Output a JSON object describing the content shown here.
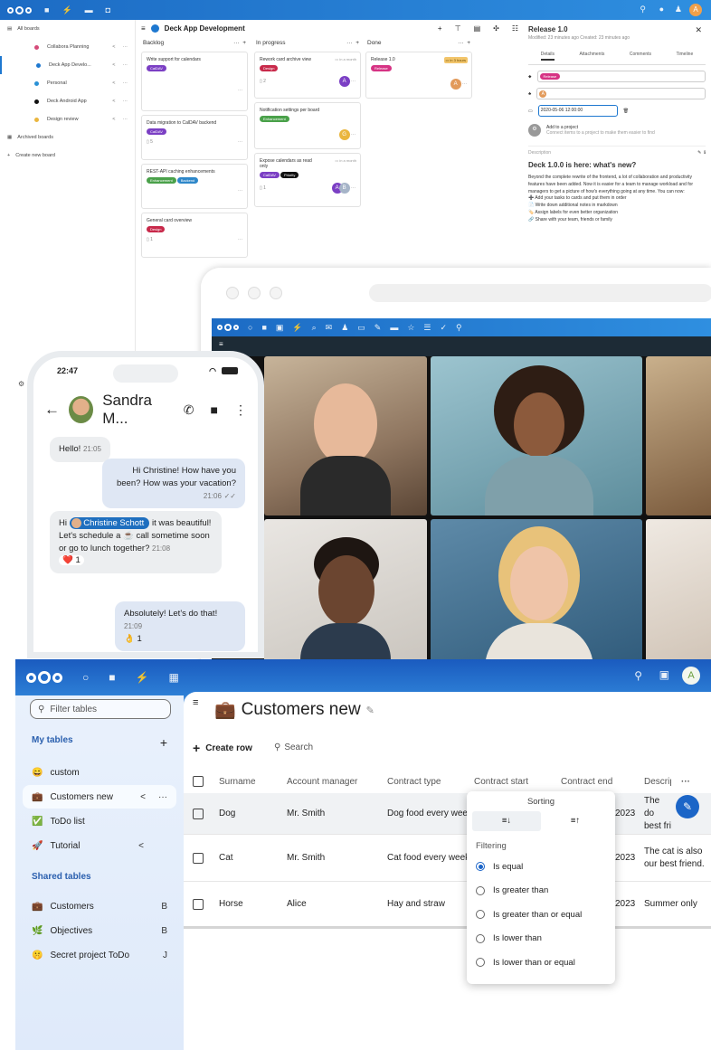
{
  "deck": {
    "nav": {
      "all_boards": "All boards",
      "boards": [
        {
          "label": "Collabora Planning",
          "color": "#d54b79"
        },
        {
          "label": "Deck App Develo...",
          "color": "#1e78d0"
        },
        {
          "label": "Personal",
          "color": "#2a91d6"
        },
        {
          "label": "Deck Android App",
          "color": "#111111"
        },
        {
          "label": "Design review",
          "color": "#eab63e"
        }
      ],
      "archived": "Archived boards",
      "create": "Create new board"
    },
    "board_title": "Deck App Development",
    "columns": [
      {
        "title": "Backlog"
      },
      {
        "title": "In progress"
      },
      {
        "title": "Done"
      }
    ],
    "cards": {
      "c1": {
        "title": "Write support for calendars",
        "tag": "CalDAV"
      },
      "c2": {
        "title": "Data migration to CalDAV backend",
        "tag": "CalDAV",
        "count": "5"
      },
      "c3": {
        "title": "REST-API caching enhancements",
        "tags": [
          "Enhancement",
          "Backend"
        ]
      },
      "c4": {
        "title": "General card overview",
        "tag": "Design",
        "count": "1"
      },
      "c5": {
        "title": "Rework card archive view",
        "due": "in a month",
        "tag": "Design",
        "count": "2",
        "avatar": "A"
      },
      "c6": {
        "title": "Notification settings per board",
        "tag": "Enhancement",
        "avatar": "G"
      },
      "c7": {
        "title": "Expose calendars as read only",
        "due": "in a month",
        "tags": [
          "CalDAV",
          "Priority"
        ],
        "count": "1",
        "avatars": [
          "A",
          "B"
        ]
      },
      "c8": {
        "title": "Release 1.0",
        "due": "in 3 hours",
        "tag": "Release",
        "avatar": "A"
      }
    },
    "sidebar": {
      "title": "Release 1.0",
      "subtitle": "Modified: 23 minutes ago Created: 23 minutes ago",
      "tabs": [
        "Details",
        "Attachments",
        "Comments",
        "Timeline"
      ],
      "tag": "Release",
      "assignee": "A",
      "date": "2020-05-06 12:00:00",
      "project_title": "Add to a project",
      "project_sub": "Connect items to a project to make them easier to find",
      "desc_label": "Description",
      "heading": "Deck 1.0.0 is here: what's new?",
      "body": "Beyond the complete rewrite of the frontend, a lot of collaboration and productivity features have been added. Now it is easier for a team to manage workload and for managers to get a picture of how's everything going at any time. You can now:",
      "bullets": [
        "➕ Add your tasks to cards and put them in order",
        "📄 Write down additional notes in markdown",
        "🏷️ Assign labels for even better organization",
        "🔗 Share with your team, friends or family"
      ]
    }
  },
  "phone": {
    "time": "22:47",
    "contact": "Sandra M...",
    "messages": [
      {
        "text": "Hello!",
        "time": "21:05"
      },
      {
        "text": "Hi Christine! How have you been? How was your vacation?",
        "time": "21:06"
      },
      {
        "pre": "Hi",
        "mention": "Christine Schott",
        "post": "it was beautiful! Let's schedule a ☕ call sometime soon or go to lunch together?",
        "time": "21:08",
        "reaction": "❤️ 1"
      },
      {
        "text": "Absolutely! Let's do that!",
        "time": "21:09",
        "reaction": "👌 1"
      }
    ]
  },
  "tables": {
    "filter_placeholder": "Filter tables",
    "my_tables_label": "My tables",
    "my_tables": [
      {
        "icon": "😄",
        "label": "custom"
      },
      {
        "icon": "💼",
        "label": "Customers new"
      },
      {
        "icon": "✅",
        "label": "ToDo list"
      },
      {
        "icon": "🚀",
        "label": "Tutorial"
      }
    ],
    "shared_label": "Shared tables",
    "shared": [
      {
        "icon": "💼",
        "label": "Customers",
        "initial": "B"
      },
      {
        "icon": "🌿",
        "label": "Objectives",
        "initial": "B"
      },
      {
        "icon": "🤫",
        "label": "Secret project ToDo",
        "initial": "J"
      }
    ],
    "title_icon": "💼",
    "title": "Customers new",
    "create_row": "Create row",
    "search": "Search",
    "columns": [
      "Surname",
      "Account manager",
      "Contract type",
      "Contract start",
      "Contract end",
      "Descrip"
    ],
    "rows": [
      {
        "surname": "Dog",
        "manager": "Mr. Smith",
        "type": "Dog food every week",
        "end": "2023",
        "desc": "The do best fri"
      },
      {
        "surname": "Cat",
        "manager": "Mr. Smith",
        "type": "Cat food every week",
        "end": "2023",
        "desc": "The cat is also our best friend."
      },
      {
        "surname": "Horse",
        "manager": "Alice",
        "type": "Hay and straw",
        "end": "2023",
        "desc": "Summer only"
      }
    ],
    "popup": {
      "sorting": "Sorting",
      "filtering": "Filtering",
      "options": [
        "Is equal",
        "Is greater than",
        "Is greater than or equal",
        "Is lower than",
        "Is lower than or equal"
      ],
      "selected": "Is equal"
    },
    "user_initial": "A"
  }
}
